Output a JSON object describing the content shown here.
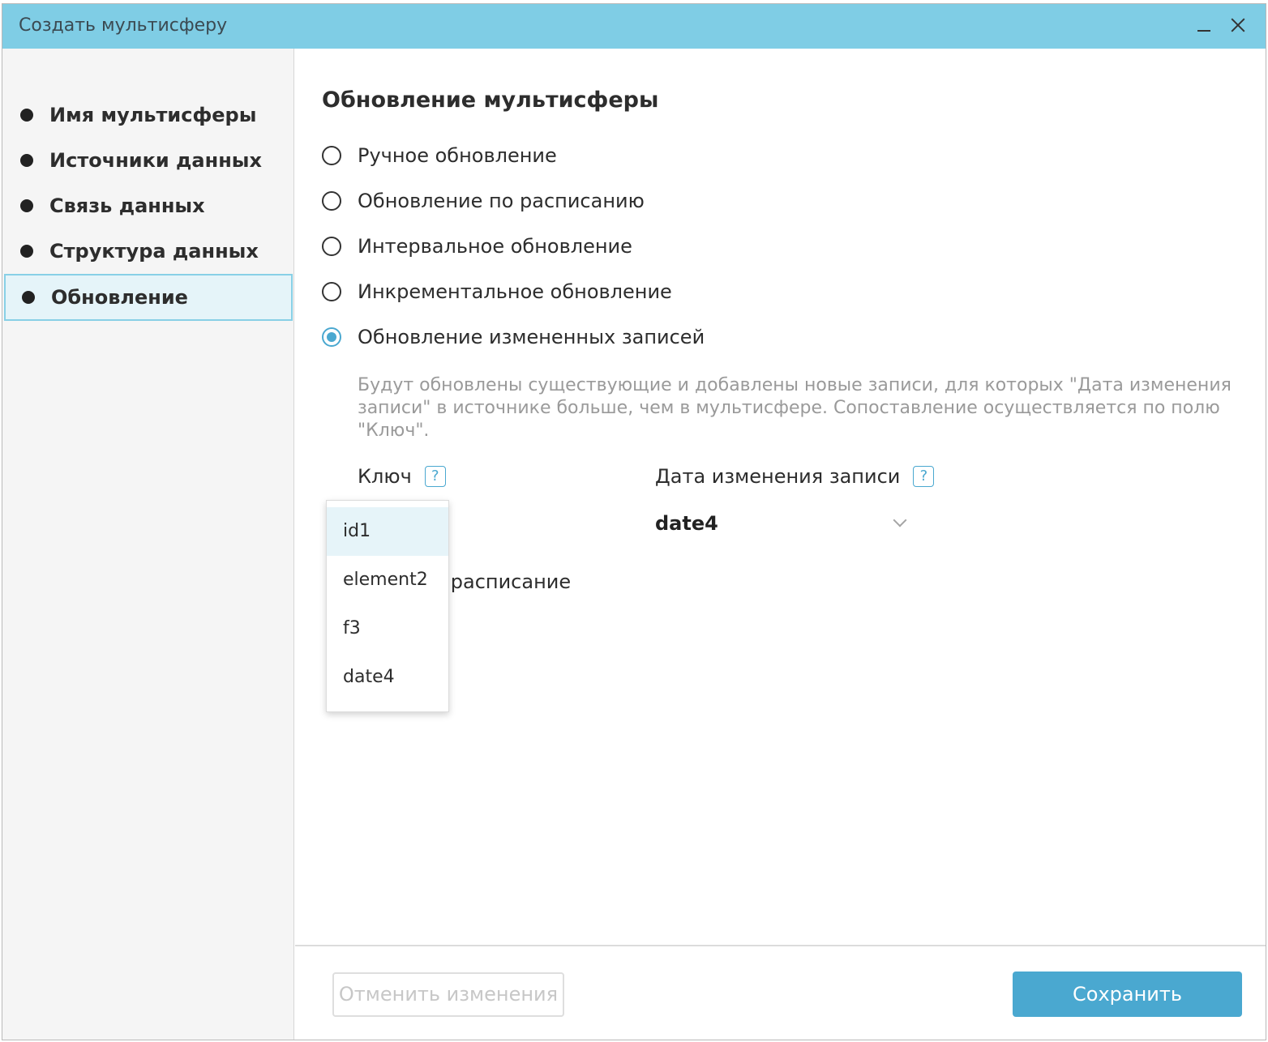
{
  "window": {
    "title": "Создать мультисферу"
  },
  "sidebar": {
    "items": [
      {
        "label": "Имя мультисферы"
      },
      {
        "label": "Источники данных"
      },
      {
        "label": "Связь данных"
      },
      {
        "label": "Структура данных"
      },
      {
        "label": "Обновление",
        "active": true
      }
    ]
  },
  "main": {
    "title": "Обновление мультисферы",
    "options": [
      {
        "label": "Ручное обновление",
        "checked": false
      },
      {
        "label": "Обновление по расписанию",
        "checked": false
      },
      {
        "label": "Интервальное обновление",
        "checked": false
      },
      {
        "label": "Инкрементальное обновление",
        "checked": false
      },
      {
        "label": "Обновление измененных записей",
        "checked": true
      }
    ],
    "hint": "Будут обновлены существующие и добавлены новые записи, для которых \"Дата изменения записи\" в источнике больше, чем в мультисфере. Сопоставление осуществляется по полю \"Ключ\".",
    "key_label": "Ключ",
    "date_label": "Дата изменения записи",
    "help_glyph": "?",
    "date_value": "date4",
    "schedule_partial": "ть расписание",
    "key_dropdown": {
      "options": [
        "id1",
        "element2",
        "f3",
        "date4"
      ],
      "hovered": "id1"
    }
  },
  "footer": {
    "cancel_label": "Отменить изменения",
    "save_label": "Сохранить"
  },
  "colors": {
    "titlebar": "#7fcde5",
    "accent": "#4aa8d0",
    "sidebar_active_bg": "#e5f4f9"
  },
  "icons": {
    "minimize": "minimize-icon",
    "close": "close-icon",
    "help": "help-icon",
    "dropdown": "chevron-down-icon"
  }
}
